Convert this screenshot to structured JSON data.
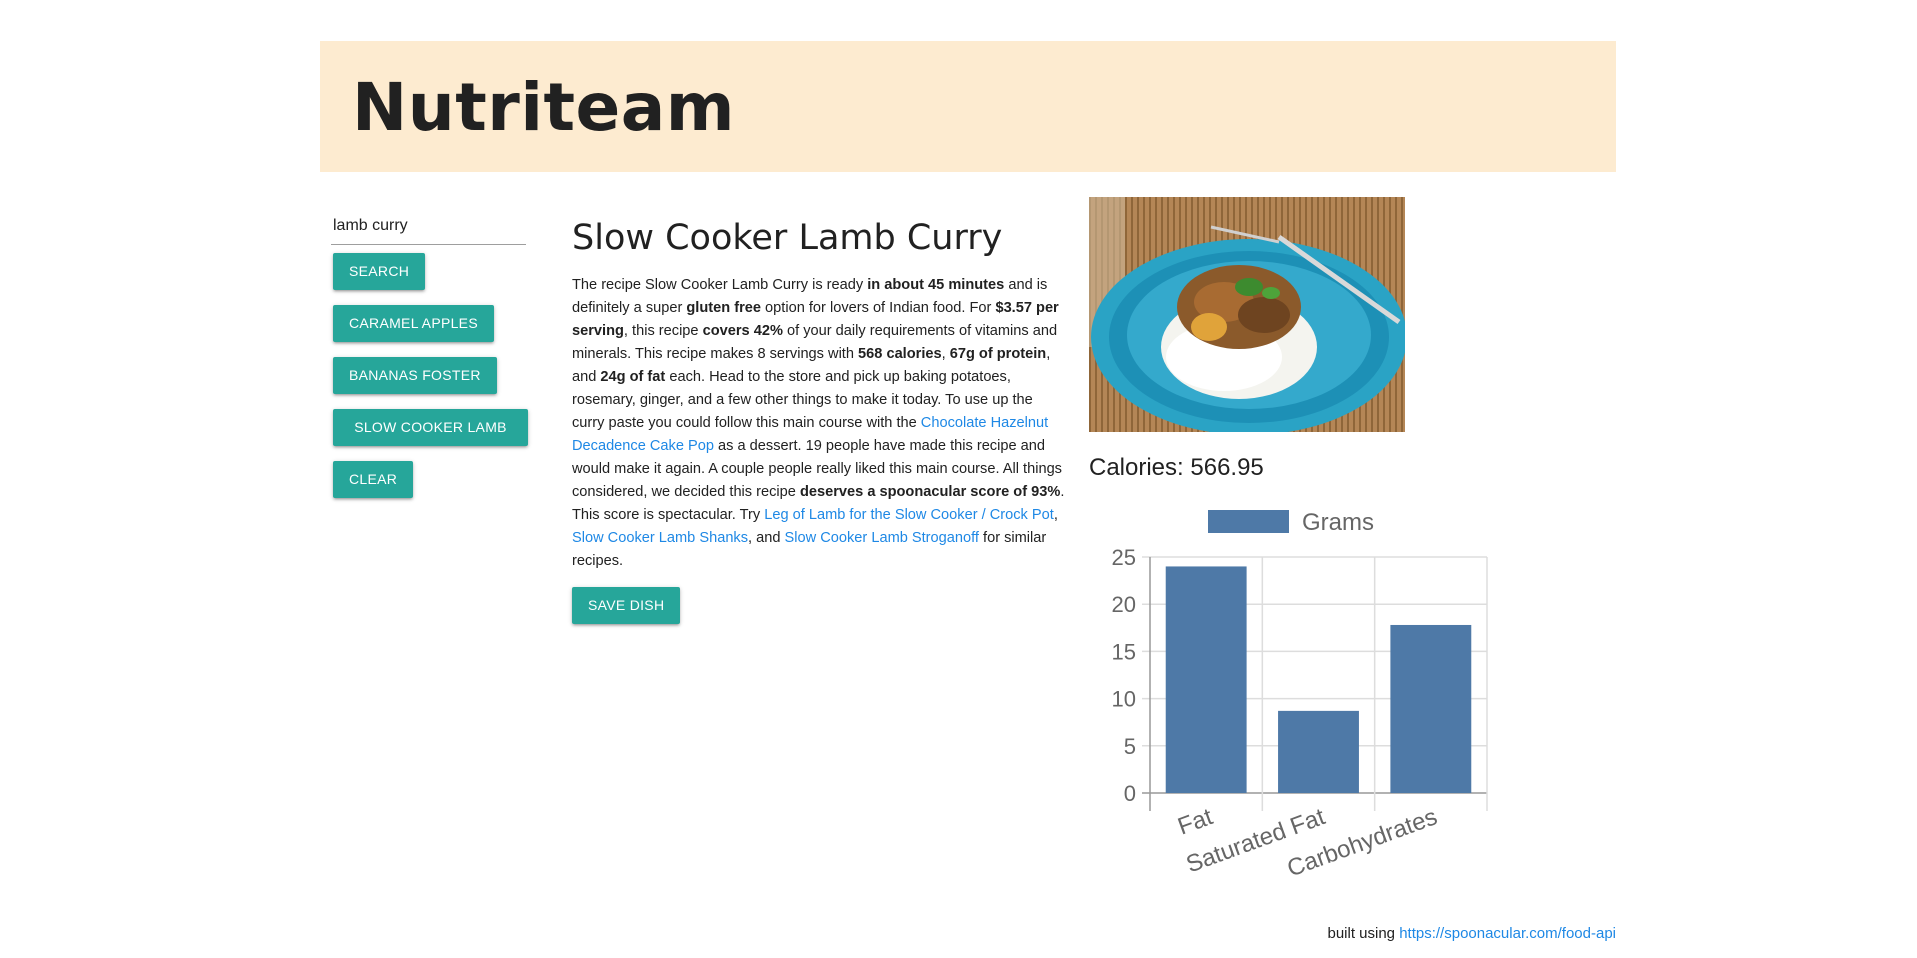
{
  "header": {
    "title": "Nutriteam"
  },
  "sidebar": {
    "search_value": "lamb curry",
    "search_button": "SEARCH",
    "saved": [
      {
        "label": "CARAMEL APPLES"
      },
      {
        "label": "BANANAS FOSTER"
      },
      {
        "label": "SLOW COOKER LAMB"
      }
    ],
    "clear_button": "CLEAR"
  },
  "recipe": {
    "title": "Slow Cooker Lamb Curry",
    "summary": {
      "t1": "The recipe Slow Cooker Lamb Curry is ready ",
      "b1": "in about 45 minutes",
      "t2": " and is definitely a super ",
      "b2": "gluten free",
      "t3": " option for lovers of Indian food. For ",
      "b3": "$3.57 per serving",
      "t4": ", this recipe ",
      "b4": "covers 42%",
      "t5": " of your daily requirements of vitamins and minerals. This recipe makes 8 servings with ",
      "b5": "568 calories",
      "t6": ", ",
      "b6": "67g of protein",
      "t7": ", and ",
      "b7": "24g of fat",
      "t8": " each. Head to the store and pick up baking potatoes, rosemary, ginger, and a few other things to make it today. To use up the curry paste you could follow this main course with the ",
      "a1": "Chocolate Hazelnut Decadence Cake Pop",
      "t9": " as a dessert. 19 people have made this recipe and would make it again. A couple people really liked this main course. All things considered, we decided this recipe ",
      "b8": "deserves a spoonacular score of 93%",
      "t10": ". This score is spectacular. Try ",
      "a2": "Leg of Lamb for the Slow Cooker / Crock Pot",
      "t11": ", ",
      "a3": "Slow Cooker Lamb Shanks",
      "t12": ", and ",
      "a4": "Slow Cooker Lamb Stroganoff",
      "t13": " for similar recipes."
    },
    "save_button": "SAVE DISH",
    "calories": "Calories: 566.95"
  },
  "chart_data": {
    "type": "bar",
    "categories": [
      "Fat",
      "Saturated Fat",
      "Carbohydrates"
    ],
    "series": [
      {
        "name": "Grams",
        "values": [
          24,
          8.7,
          17.8
        ]
      }
    ],
    "ylim": [
      0,
      25
    ],
    "yticks": [
      0,
      5,
      10,
      15,
      20,
      25
    ],
    "legend": "top",
    "grid": true,
    "color": "#4e79a7"
  },
  "footer": {
    "prefix": "built using ",
    "link": "https://spoonacular.com/food-api"
  },
  "colors": {
    "header_bg": "#fdebd0",
    "button": "#26a69a",
    "link": "#1e88e5",
    "bar": "#4e79a7"
  }
}
